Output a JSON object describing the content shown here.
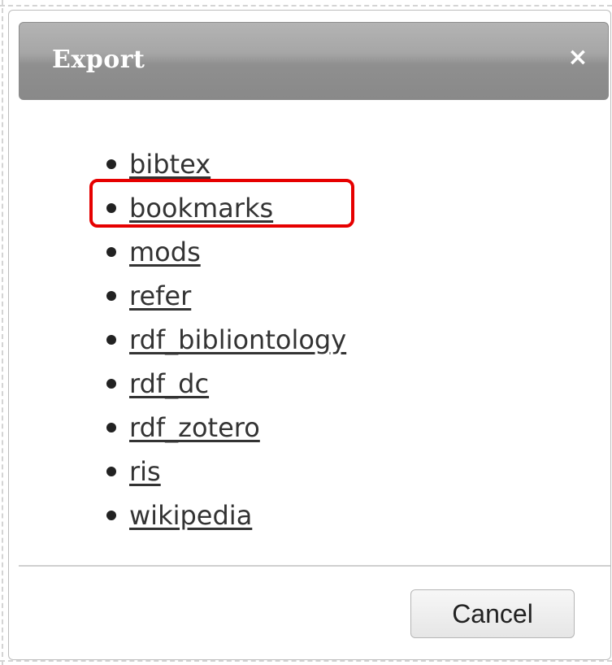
{
  "dialog": {
    "title": "Export",
    "close_icon": "close-icon",
    "close_glyph": "×"
  },
  "formats": [
    {
      "label": "bibtex"
    },
    {
      "label": "bookmarks"
    },
    {
      "label": "mods"
    },
    {
      "label": "refer"
    },
    {
      "label": "rdf_bibliontology"
    },
    {
      "label": "rdf_dc"
    },
    {
      "label": "rdf_zotero"
    },
    {
      "label": "ris"
    },
    {
      "label": "wikipedia"
    }
  ],
  "highlighted_format": "bookmarks",
  "footer": {
    "cancel_label": "Cancel"
  },
  "colors": {
    "highlight": "#e60000",
    "titlebar": "#9a9a9a",
    "link": "#333333"
  }
}
